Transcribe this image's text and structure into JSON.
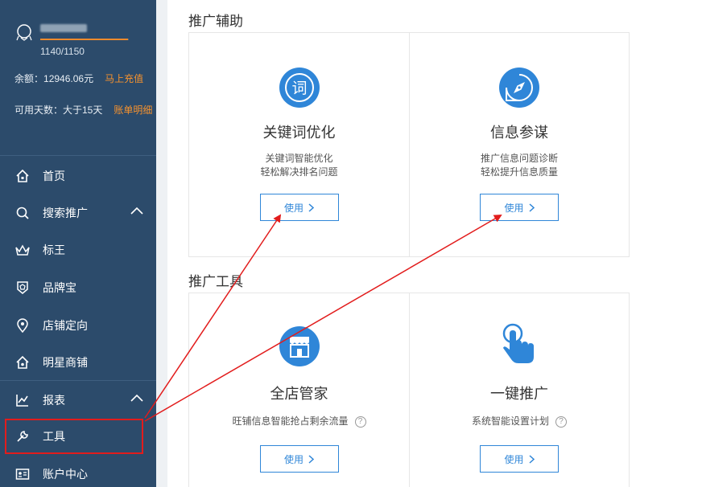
{
  "user": {
    "progress_text": "1140/1150",
    "progress_ratio": 0.991
  },
  "account": {
    "balance_label": "余额：",
    "balance_value": "12946.06元",
    "recharge_link": "马上充值",
    "days_label": "可用天数：大于15天",
    "bill_link": "账单明细"
  },
  "nav": {
    "home": "首页",
    "search_promo": "搜索推广",
    "biaowang": "标王",
    "brand": "品牌宝",
    "store_target": "店铺定向",
    "star_store": "明星商铺",
    "reports": "报表",
    "tools": "工具",
    "account_center": "账户中心"
  },
  "sections": {
    "assist_title": "推广辅助",
    "tools_title": "推广工具"
  },
  "cards": {
    "keyword": {
      "icon_char": "词",
      "title": "关键词优化",
      "desc1": "关键词智能优化",
      "desc2": "轻松解决排名问题",
      "button": "使用"
    },
    "info": {
      "title": "信息参谋",
      "desc1": "推广信息问题诊断",
      "desc2": "轻松提升信息质量",
      "button": "使用"
    },
    "store": {
      "title": "全店管家",
      "desc1": "旺铺信息智能抢占剩余流量",
      "help": "?",
      "button": "使用"
    },
    "onekey": {
      "title": "一键推广",
      "desc1": "系统智能设置计划",
      "help": "?",
      "button": "使用"
    }
  },
  "colors": {
    "sidebar_bg": "#2c4b6b",
    "accent_blue": "#2f86d8",
    "link_orange": "#f6922e",
    "annotation_red": "#e21c1c"
  }
}
